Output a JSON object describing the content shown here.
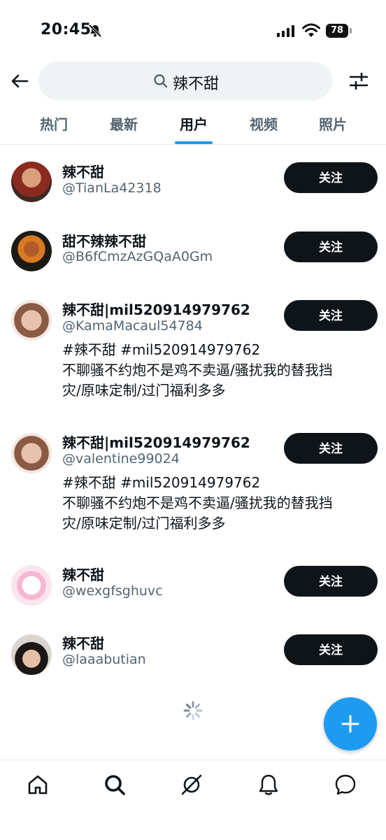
{
  "status": {
    "time": "20:45",
    "battery": "78"
  },
  "search": {
    "query": "辣不甜"
  },
  "tabs": [
    {
      "label": "热门"
    },
    {
      "label": "最新"
    },
    {
      "label": "用户"
    },
    {
      "label": "视频"
    },
    {
      "label": "照片"
    }
  ],
  "active_tab": "用户",
  "users": [
    {
      "name": "辣不甜",
      "handle": "@TianLa42318",
      "button": "关注"
    },
    {
      "name": "甜不辣辣不甜",
      "handle": "@B6fCmzAzGQaA0Gm",
      "button": "关注"
    },
    {
      "name": "辣不甜|mil520914979762",
      "handle": "@KamaMacaul54784",
      "button": "关注",
      "bio": [
        "#辣不甜 #mil520914979762",
        "不聊骚不约炮不是鸡不卖逼/骚扰我的替我挡",
        "灾/原味定制/过门福利多多"
      ]
    },
    {
      "name": "辣不甜|mil520914979762",
      "handle": "@valentine99024",
      "button": "关注",
      "bio": [
        "#辣不甜 #mil520914979762",
        "不聊骚不约炮不是鸡不卖逼/骚扰我的替我挡",
        "灾/原味定制/过门福利多多"
      ]
    },
    {
      "name": "辣不甜",
      "handle": "@wexgfsghuvc",
      "button": "关注"
    },
    {
      "name": "辣不甜",
      "handle": "@laaabutian",
      "button": "关注"
    }
  ],
  "icons": {
    "back": "arrow-left-icon",
    "search": "search-icon",
    "filter": "sliders-icon",
    "compose": "plus-icon",
    "nav": [
      "home-icon",
      "search-icon",
      "grok-icon",
      "bell-icon",
      "message-icon"
    ]
  },
  "colors": {
    "accent": "#1d9bf0",
    "button": "#0f1419",
    "secondary_text": "#536471"
  }
}
